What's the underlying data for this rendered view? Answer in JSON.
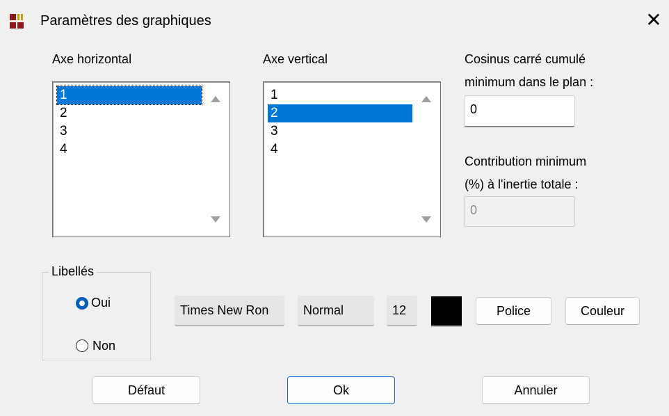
{
  "window": {
    "title": "Paramètres des graphiques",
    "close_glyph": "✕",
    "app_icon": "grid-app-icon"
  },
  "horizontal_axis": {
    "label": "Axe horizontal",
    "items": [
      "1",
      "2",
      "3",
      "4"
    ],
    "selected": "1"
  },
  "vertical_axis": {
    "label": "Axe vertical",
    "items": [
      "1",
      "2",
      "3",
      "4"
    ],
    "selected": "2"
  },
  "cosinus": {
    "label_line1": "Cosinus carré cumulé",
    "label_line2": "minimum dans le plan :",
    "value": "0"
  },
  "contribution": {
    "label_line1": "Contribution minimum",
    "label_line2": "(%) à l'inertie totale :",
    "value": "0"
  },
  "labels_group": {
    "title": "Libellés",
    "option_yes": "Oui",
    "option_no": "Non",
    "selected": "Oui"
  },
  "font": {
    "name": "Times New Ron",
    "style": "Normal",
    "size": "12",
    "color": "#000000",
    "font_button": "Police",
    "color_button": "Couleur"
  },
  "footer": {
    "default_button": "Défaut",
    "ok_button": "Ok",
    "cancel_button": "Annuler"
  },
  "colors": {
    "selection": "#0078d7",
    "dialog_bg": "#f0f0f0",
    "default_button_border": "#1a6fc4"
  }
}
